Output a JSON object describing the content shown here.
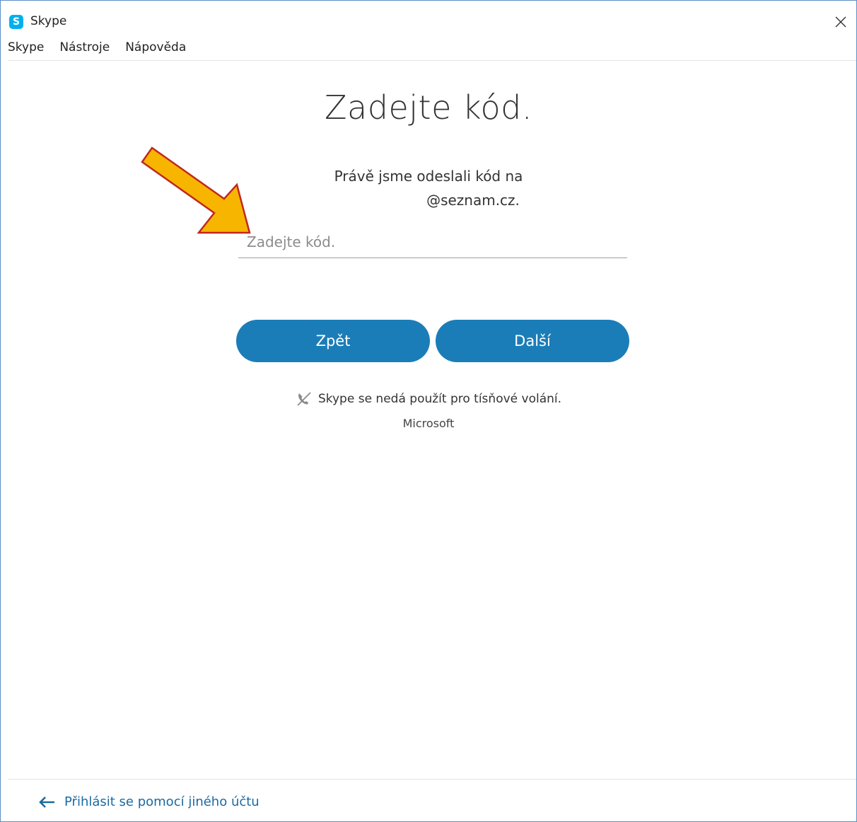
{
  "window": {
    "title": "Skype",
    "icon_letter": "S",
    "close_glyph": "×"
  },
  "menu": {
    "items": [
      "Skype",
      "Nástroje",
      "Nápověda"
    ]
  },
  "main": {
    "heading": "Zadejte kód.",
    "sent_line1": "Právě jsme odeslali kód na",
    "sent_line2": "@seznam.cz.",
    "code_placeholder": "Zadejte kód.",
    "back_label": "Zpět",
    "next_label": "Další",
    "emergency_notice": "Skype se nedá použít pro tísňové volání.",
    "brand": "Microsoft"
  },
  "footer": {
    "switch_account_label": "Přihlásit se pomocí jiného účtu"
  },
  "colors": {
    "accent": "#1b7db8",
    "skype_blue": "#00aff0",
    "link": "#1a6aa3",
    "annotation_arrow_fill": "#f7b500",
    "annotation_arrow_stroke": "#c0281e"
  },
  "icons": {
    "app": "skype-logo-icon",
    "close": "close-icon",
    "emergency": "no-phone-icon",
    "back_arrow": "arrow-left-icon",
    "annotation": "annotation-arrow-icon"
  }
}
